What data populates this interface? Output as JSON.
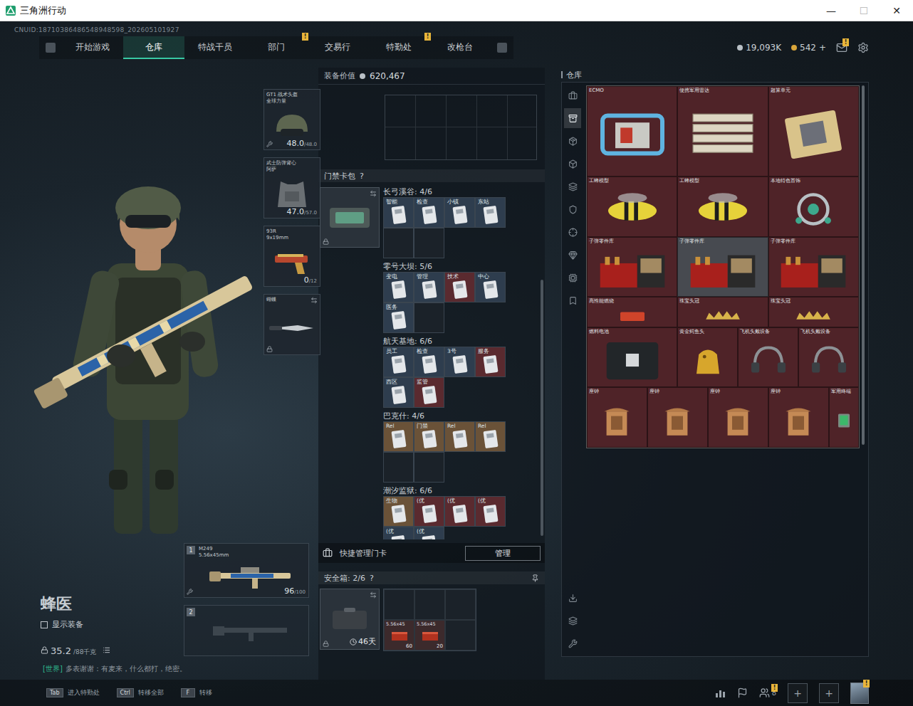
{
  "window": {
    "title": "三角洲行动",
    "controls": [
      {
        "symbol": "—",
        "disabled": false
      },
      {
        "symbol": "☐",
        "disabled": true
      },
      {
        "symbol": "✕",
        "disabled": false
      }
    ]
  },
  "header": {
    "uid": "CNUID:18710386486548948598_202605101927",
    "tabs": [
      {
        "label": "开始游戏",
        "selected": false,
        "badge": ""
      },
      {
        "label": "仓库",
        "selected": true,
        "badge": ""
      },
      {
        "label": "特战干员",
        "selected": false,
        "badge": ""
      },
      {
        "label": "部门",
        "selected": false,
        "badge": "!"
      },
      {
        "label": "交易行",
        "selected": false,
        "badge": ""
      },
      {
        "label": "特勤处",
        "selected": false,
        "badge": "!"
      },
      {
        "label": "改枪台",
        "selected": false,
        "badge": ""
      }
    ],
    "currencies": [
      {
        "amount": "19,093K",
        "color": "#b9c0c6",
        "add": ""
      },
      {
        "amount": "542",
        "color": "#d9a53a",
        "add": "+"
      }
    ],
    "mail_badge": "!"
  },
  "operator": {
    "name": "蜂医",
    "show_gear": {
      "label": "显示装备",
      "checked": false
    },
    "weight": "35.2",
    "weight_max": "/88千克",
    "chat_channel": "[世界]",
    "chat_text": "多表谢谢：有麦来，什么都打，绝密。"
  },
  "equipment": [
    {
      "kind": "helmet",
      "name": "GT1 战术头盔",
      "sub": "全球力量",
      "value": "48.0",
      "max": "/48.0",
      "swap": false,
      "locked": false,
      "no_repair": true
    },
    {
      "kind": "vest",
      "name": "武士防弹背心",
      "sub": "阿萨",
      "value": "47.0",
      "max": "/57.0",
      "swap": false,
      "locked": false,
      "no_repair": false
    },
    {
      "kind": "pistol",
      "name": "93R",
      "sub": "9x19mm",
      "value": "0",
      "max": "/12",
      "swap": false,
      "locked": false,
      "no_repair": false
    },
    {
      "kind": "knife",
      "name": "蝴蝶",
      "sub": "",
      "value": "",
      "max": "",
      "swap": true,
      "locked": true,
      "no_repair": false
    }
  ],
  "weapons": [
    {
      "index": "1",
      "name": "M249",
      "caliber": "5.56x45mm",
      "ammo": "96",
      "max": "/100",
      "filled": true
    },
    {
      "index": "2",
      "name": "",
      "caliber": "",
      "ammo": "",
      "max": "",
      "filled": false
    }
  ],
  "loadout": {
    "label": "装备价值",
    "value": "620,467"
  },
  "keycards": {
    "title": "门禁卡包",
    "help": "?",
    "maps": [
      {
        "name": "长弓溪谷:",
        "count": "4/6",
        "capacity": 6,
        "cards": [
          {
            "label": "智能",
            "color": "#2e3d4e"
          },
          {
            "label": "检查",
            "color": "#2e3d4e"
          },
          {
            "label": "小镇",
            "color": "#2e3d4e"
          },
          {
            "label": "东站",
            "color": "#2e3d4e"
          }
        ]
      },
      {
        "name": "零号大坝:",
        "count": "5/6",
        "capacity": 6,
        "cards": [
          {
            "label": "变电",
            "color": "#2e3d4e"
          },
          {
            "label": "管理",
            "color": "#2e3d4e"
          },
          {
            "label": "技术",
            "color": "#5a2a2f"
          },
          {
            "label": "中心",
            "color": "#2e3d4e"
          },
          {
            "label": "医务",
            "color": "#2e3d4e"
          }
        ]
      },
      {
        "name": "航天基地:",
        "count": "6/6",
        "capacity": 6,
        "cards": [
          {
            "label": "员工",
            "color": "#2e3d4e"
          },
          {
            "label": "检查",
            "color": "#2e3d4e"
          },
          {
            "label": "3号",
            "color": "#2e3d4e"
          },
          {
            "label": "服务",
            "color": "#5a2a2f"
          },
          {
            "label": "西区",
            "color": "#2e3d4e"
          },
          {
            "label": "监管",
            "color": "#5a2a2f"
          }
        ]
      },
      {
        "name": "巴克什:",
        "count": "4/6",
        "capacity": 6,
        "cards": [
          {
            "label": "Rel",
            "color": "#6a5238"
          },
          {
            "label": "门禁",
            "color": "#6a5238"
          },
          {
            "label": "Rel",
            "color": "#6a5238"
          },
          {
            "label": "Rel",
            "color": "#6a5238"
          }
        ]
      },
      {
        "name": "潮汐监狱:",
        "count": "6/6",
        "capacity": 6,
        "cards": [
          {
            "label": "生物",
            "color": "#6a5238"
          },
          {
            "label": "(优",
            "color": "#5a2a2f"
          },
          {
            "label": "(优",
            "color": "#5a2a2f"
          },
          {
            "label": "(优",
            "color": "#5a2a2f"
          },
          {
            "label": "(优",
            "color": "#2e3d4e"
          },
          {
            "label": "(优",
            "color": "#2e3d4e"
          }
        ]
      }
    ]
  },
  "quick": {
    "label": "快捷管理门卡",
    "button": "管理"
  },
  "safe": {
    "title": "安全箱:",
    "count": "2/6",
    "help": "?",
    "timer": "46天",
    "slots": [
      {
        "filled": false,
        "name": "",
        "count": ""
      },
      {
        "filled": false,
        "name": "",
        "count": ""
      },
      {
        "filled": false,
        "name": "",
        "count": ""
      },
      {
        "filled": true,
        "name": "5.56x45",
        "count": "60"
      },
      {
        "filled": true,
        "name": "5.56x45",
        "count": "20"
      },
      {
        "filled": false,
        "name": "",
        "count": ""
      }
    ]
  },
  "stash": {
    "title": "仓库",
    "categories": [
      {
        "selected": false
      },
      {
        "selected": true
      },
      {
        "selected": false
      },
      {
        "selected": false
      },
      {
        "selected": false
      },
      {
        "selected": false
      },
      {
        "selected": false
      },
      {
        "selected": false
      },
      {
        "selected": false
      },
      {
        "selected": false
      }
    ],
    "tools": [
      {
        "selected": false
      },
      {
        "selected": false
      },
      {
        "selected": false
      }
    ],
    "items": [
      {
        "name": "ECMO",
        "kind": "machine",
        "cols": 3,
        "rows": 3,
        "color": "#4f2328",
        "highlighted": false
      },
      {
        "name": "便携军用雷达",
        "kind": "radar",
        "cols": 3,
        "rows": 3,
        "color": "#4f2328",
        "highlighted": false
      },
      {
        "name": "超算单元",
        "kind": "chip",
        "cols": 3,
        "rows": 3,
        "color": "#4f2328",
        "highlighted": false
      },
      {
        "name": "工蜂模型",
        "kind": "bee",
        "cols": 3,
        "rows": 2,
        "color": "#4f2328",
        "highlighted": false
      },
      {
        "name": "工蜂模型",
        "kind": "bee",
        "cols": 3,
        "rows": 2,
        "color": "#4f2328",
        "highlighted": false
      },
      {
        "name": "本地特色首饰",
        "kind": "jewel",
        "cols": 3,
        "rows": 2,
        "color": "#4f2328",
        "highlighted": false
      },
      {
        "name": "子弹零件库",
        "kind": "ammo",
        "cols": 3,
        "rows": 2,
        "color": "#4f2328",
        "highlighted": false
      },
      {
        "name": "子弹零件库",
        "kind": "ammo",
        "cols": 3,
        "rows": 2,
        "color": "#4f2328",
        "highlighted": true
      },
      {
        "name": "子弹零件库",
        "kind": "ammo",
        "cols": 3,
        "rows": 2,
        "color": "#4f2328",
        "highlighted": false
      },
      {
        "name": "高性能燃烧",
        "kind": "fuel",
        "cols": 3,
        "rows": 1,
        "color": "#4f2328",
        "highlighted": false
      },
      {
        "name": "珠宝头冠",
        "kind": "crown",
        "cols": 3,
        "rows": 1,
        "color": "#4f2328",
        "highlighted": false
      },
      {
        "name": "珠宝头冠",
        "kind": "crown",
        "cols": 3,
        "rows": 1,
        "color": "#4f2328",
        "highlighted": false
      },
      {
        "name": "燃料电池",
        "kind": "battery",
        "cols": 3,
        "rows": 2,
        "color": "#4f2328",
        "highlighted": false
      },
      {
        "name": "黄金鳄鱼头",
        "kind": "statue",
        "cols": 2,
        "rows": 2,
        "color": "#4f2328",
        "highlighted": false
      },
      {
        "name": "飞机头戴设备",
        "kind": "headset",
        "cols": 2,
        "rows": 2,
        "color": "#4f2328",
        "highlighted": false
      },
      {
        "name": "飞机头戴设备",
        "kind": "headset",
        "cols": 2,
        "rows": 2,
        "color": "#4f2328",
        "highlighted": false
      },
      {
        "name": "座钟",
        "kind": "clock",
        "cols": 2,
        "rows": 2,
        "color": "#4f2328",
        "highlighted": false
      },
      {
        "name": "座钟",
        "kind": "clock",
        "cols": 2,
        "rows": 2,
        "color": "#4f2328",
        "highlighted": false
      },
      {
        "name": "座钟",
        "kind": "clock",
        "cols": 2,
        "rows": 2,
        "color": "#4f2328",
        "highlighted": false
      },
      {
        "name": "座钟",
        "kind": "clock",
        "cols": 2,
        "rows": 2,
        "color": "#4f2328",
        "highlighted": false
      },
      {
        "name": "军用终端",
        "kind": "terminal",
        "cols": 1,
        "rows": 2,
        "color": "#4f2328",
        "highlighted": false
      }
    ]
  },
  "hints": [
    {
      "key": "Tab",
      "label": "进入特勤处"
    },
    {
      "key": "Ctrl",
      "label": "转移全部"
    },
    {
      "key": "F",
      "label": "转移"
    }
  ],
  "social": {
    "friends": "8",
    "friends_badge": "!",
    "team_slots": [
      "+",
      "+"
    ],
    "avatar_badge": "!"
  }
}
